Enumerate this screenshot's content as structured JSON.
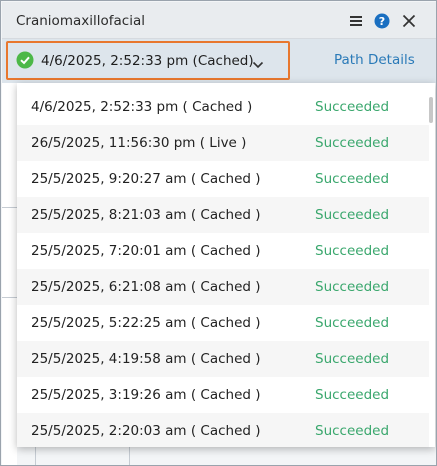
{
  "panel": {
    "title": "Craniomaxillofacial",
    "icons": [
      "menu-icon",
      "help-icon",
      "close-icon"
    ]
  },
  "runbar": {
    "selected_label": "4/6/2025, 2:52:33 pm (Cached)",
    "status_icon": "check-circle-icon",
    "path_details_label": "Path Details"
  },
  "colors": {
    "accent_border": "#e8772e",
    "success": "#3aa76d",
    "link": "#2a7ab8",
    "check_green": "#4cb848",
    "help_blue": "#1a6fc1"
  },
  "runs": [
    {
      "date": "4/6/2025, 2:52:33 pm ( Cached )",
      "status": "Succeeded"
    },
    {
      "date": "26/5/2025, 11:56:30 pm ( Live )",
      "status": "Succeeded"
    },
    {
      "date": "25/5/2025, 9:20:27 am ( Cached )",
      "status": "Succeeded"
    },
    {
      "date": "25/5/2025, 8:21:03 am ( Cached )",
      "status": "Succeeded"
    },
    {
      "date": "25/5/2025, 7:20:01 am ( Cached )",
      "status": "Succeeded"
    },
    {
      "date": "25/5/2025, 6:21:08 am ( Cached )",
      "status": "Succeeded"
    },
    {
      "date": "25/5/2025, 5:22:25 am ( Cached )",
      "status": "Succeeded"
    },
    {
      "date": "25/5/2025, 4:19:58 am ( Cached )",
      "status": "Succeeded"
    },
    {
      "date": "25/5/2025, 3:19:26 am ( Cached )",
      "status": "Succeeded"
    },
    {
      "date": "25/5/2025, 2:20:03 am ( Cached )",
      "status": "Succeeded"
    }
  ]
}
